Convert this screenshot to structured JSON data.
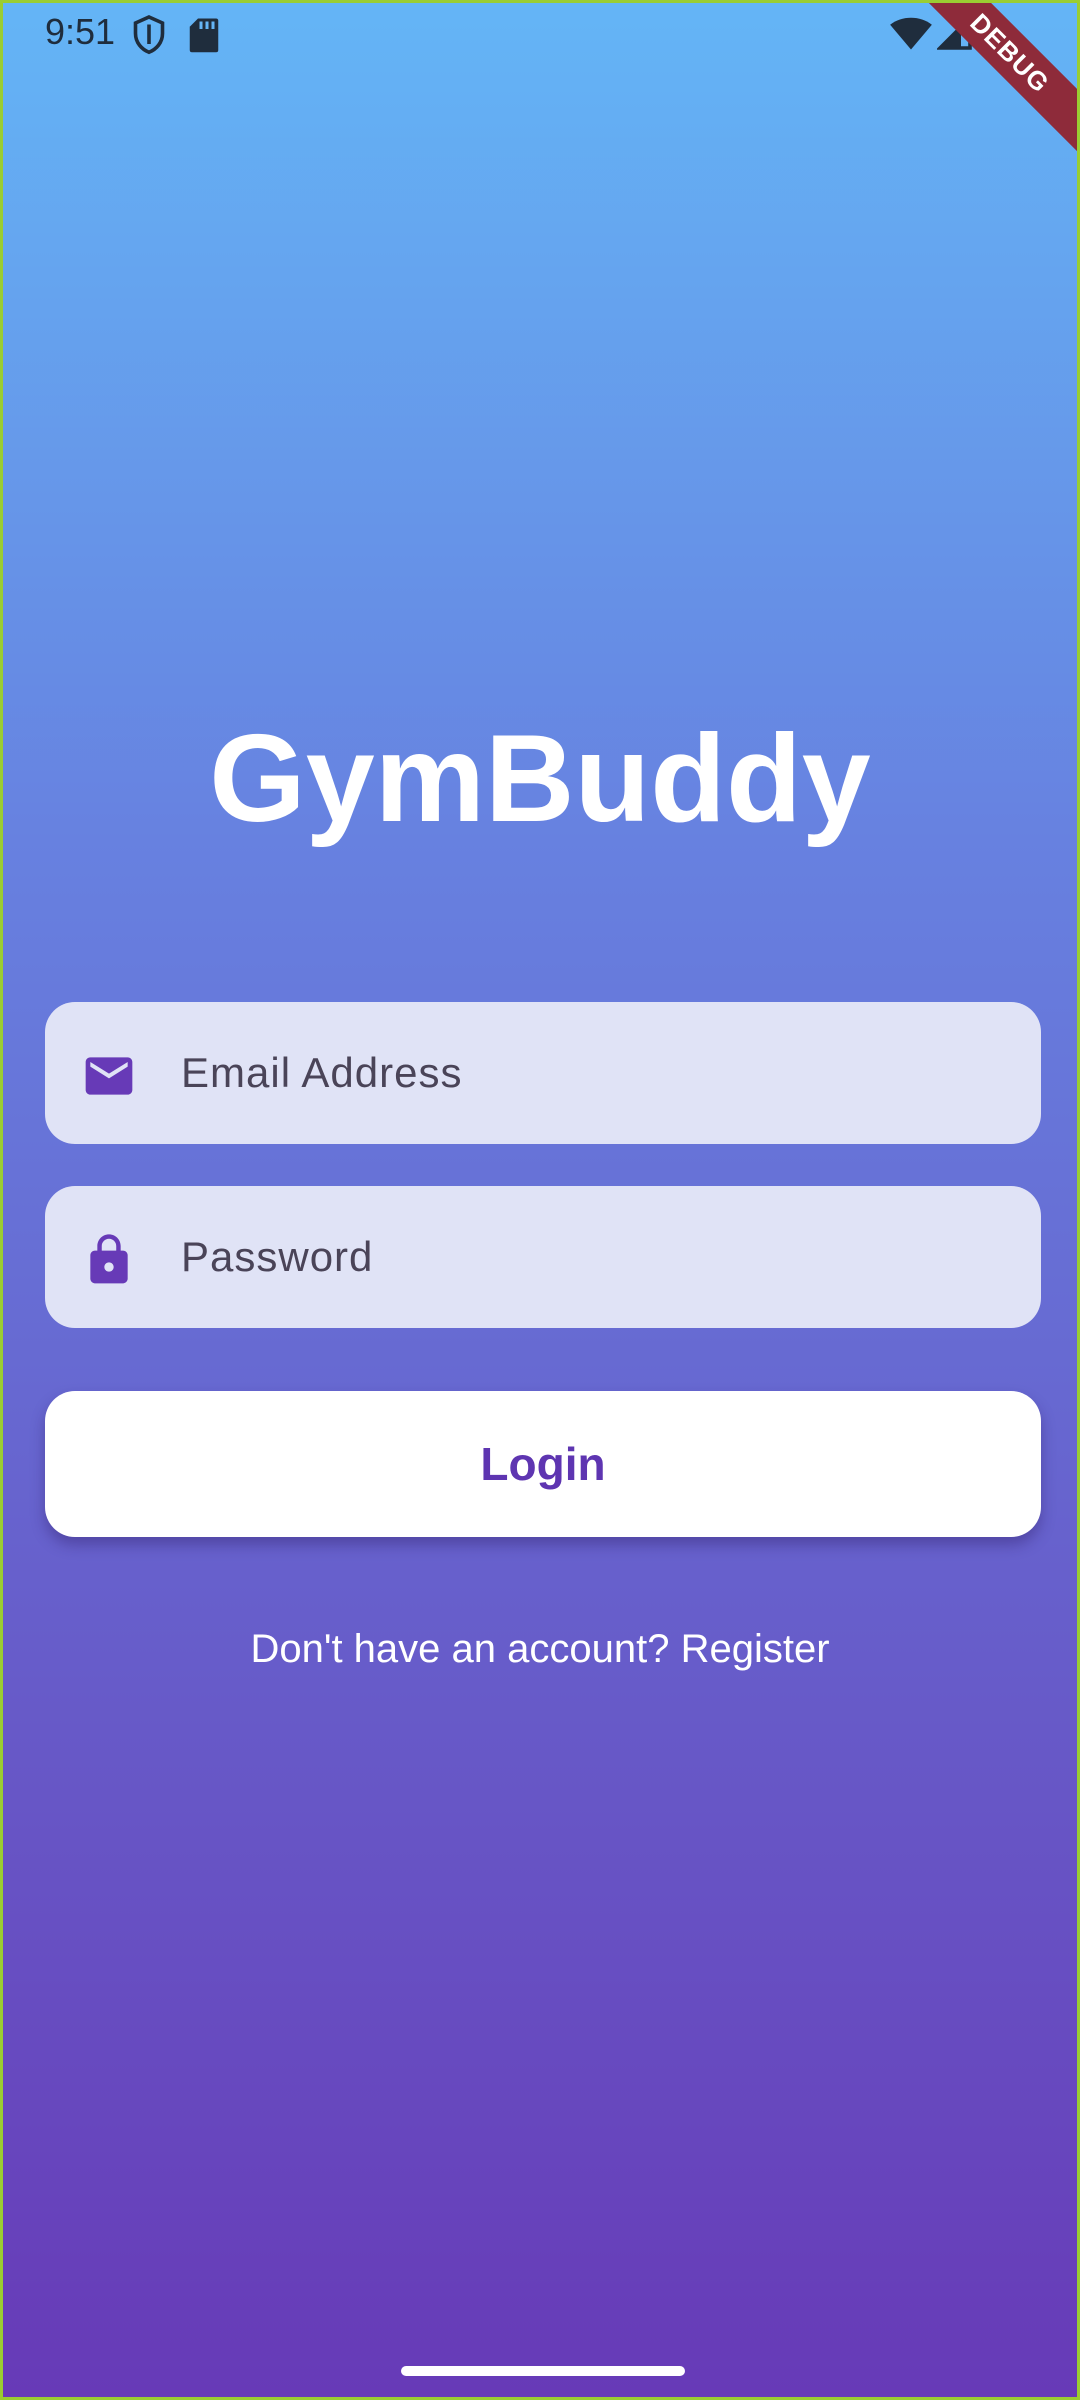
{
  "status_bar": {
    "time": "9:51",
    "icons_left": [
      "shield-icon",
      "sd-card-icon"
    ],
    "icons_right": [
      "wifi-icon",
      "cell-signal-icon",
      "battery-icon"
    ]
  },
  "debug_banner": {
    "label": "DEBUG"
  },
  "app": {
    "title": "GymBuddy"
  },
  "form": {
    "email": {
      "placeholder": "Email Address",
      "value": "",
      "icon": "email-icon"
    },
    "password": {
      "placeholder": "Password",
      "value": "",
      "icon": "lock-icon"
    },
    "login_label": "Login",
    "register_text": "Don't have an account? Register"
  },
  "colors": {
    "gradient_top": "#64b5f6",
    "gradient_bottom": "#673ab7",
    "field_background": "#e0e3f6",
    "accent": "#5e35b1",
    "button_background": "#ffffff"
  }
}
